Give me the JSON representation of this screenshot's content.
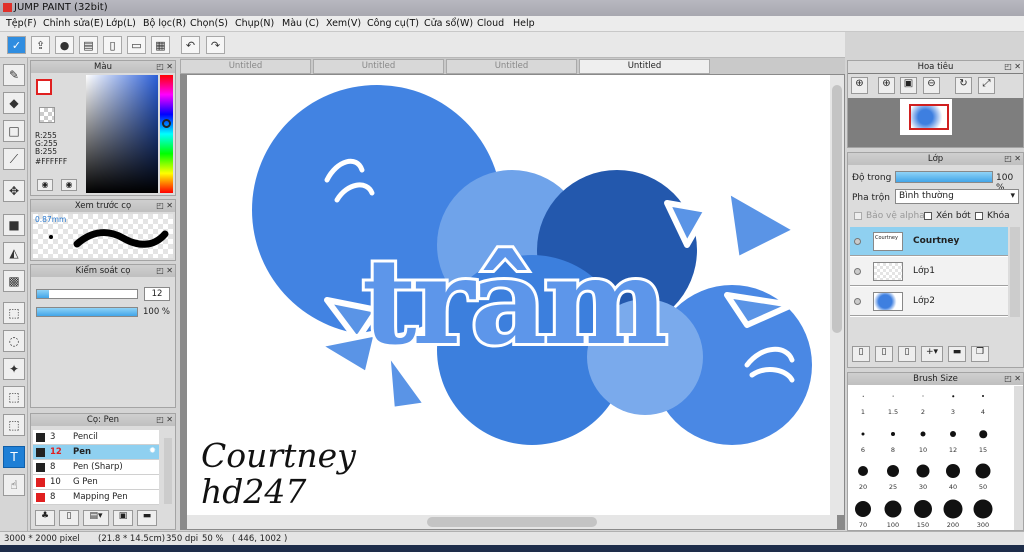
{
  "window": {
    "title": "JUMP PAINT (32bit)"
  },
  "menu": [
    "Tệp(F)",
    "Chỉnh sửa(E)",
    "Lớp(L)",
    "Bộ lọc(R)",
    "Chọn(S)",
    "Chụp(N)",
    "Màu (C)",
    "Xem(V)",
    "Công cụ(T)",
    "Cửa sổ(W)",
    "Cloud",
    "Help"
  ],
  "color_panel": {
    "title": "Màu",
    "r": "R:255",
    "g": "G:255",
    "b": "B:255",
    "hex": "#FFFFFF"
  },
  "preview_panel": {
    "title": "Xem trước cọ",
    "size": "0.87mm"
  },
  "control_panel": {
    "title": "Kiểm soát cọ",
    "size_value": "12",
    "opacity_value": "100 %",
    "opacity_fraction": 1.0,
    "size_fraction": 0.12
  },
  "brush_panel": {
    "title": "Cọ: Pen",
    "brushes": [
      {
        "num": "3",
        "name": "Pencil",
        "color": "#222222"
      },
      {
        "num": "12",
        "name": "Pen",
        "color": "#222222",
        "selected": true
      },
      {
        "num": "8",
        "name": "Pen (Sharp)",
        "color": "#222222"
      },
      {
        "num": "10",
        "name": "G Pen",
        "color": "#e02020"
      },
      {
        "num": "8",
        "name": "Mapping Pen",
        "color": "#e02020"
      }
    ]
  },
  "doc_tabs": [
    "Untitled",
    "Untitled",
    "Untitled",
    "Untitled"
  ],
  "canvas": {
    "text_line1": "Courtney",
    "text_line2": "hd247",
    "title_text": "trâm"
  },
  "navigator": {
    "title": "Hoa tiêu"
  },
  "layers_panel": {
    "title": "Lớp",
    "opacity_label": "Độ trong",
    "opacity_value": "100 %",
    "blend_label": "Pha trộn",
    "blend_value": "Bình thường",
    "protect_alpha": "Bảo vệ alpha",
    "clip": "Xén bớt",
    "lock": "Khóa",
    "layers": [
      {
        "name": "Courtney",
        "selected": true
      },
      {
        "name": "Lớp1"
      },
      {
        "name": "Lớp2"
      }
    ]
  },
  "brush_size_panel": {
    "title": "Brush Size",
    "row_labels": [
      [
        "1",
        "1.5",
        "2",
        "3",
        "4"
      ],
      [
        "6",
        "8",
        "10",
        "12",
        "15"
      ],
      [
        "20",
        "25",
        "30",
        "40",
        "50"
      ],
      [
        "70",
        "100",
        "150",
        "200",
        "300"
      ]
    ]
  },
  "status": {
    "dimensions": "3000 * 2000 pixel",
    "physical": "(21.8 * 14.5cm)",
    "dpi": "350 dpi",
    "zoom": "50 %",
    "coords": "( 446, 1002 )"
  },
  "colors": {
    "accent": "#1e7fd6",
    "selected_row": "#8fd0f0",
    "art_blue": "#3f80e0"
  }
}
